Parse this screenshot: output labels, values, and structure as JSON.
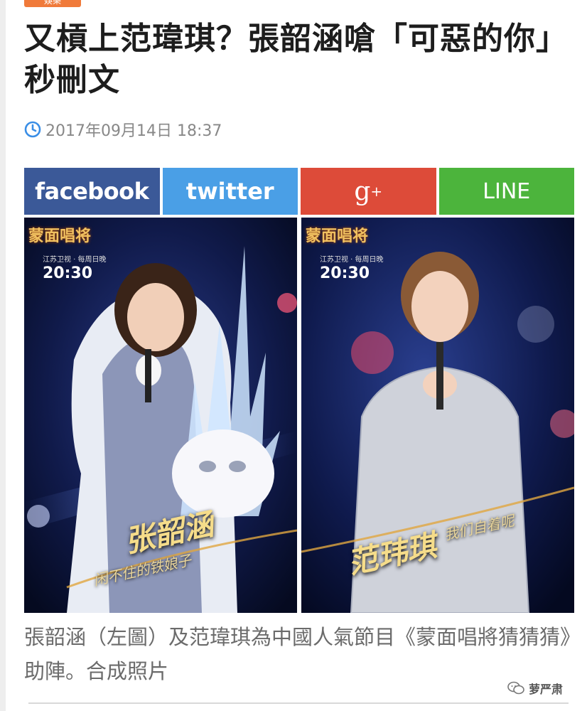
{
  "article": {
    "category": "娛樂",
    "title": "又槓上范瑋琪？張韶涵嗆「可惡的你」秒刪文",
    "date": "2017年09月14日 18:37",
    "caption": "張韶涵（左圖）及范瑋琪為中國人氣節目《蒙面唱將猜猜猜》助陣。合成照片"
  },
  "share": {
    "facebook": "facebook",
    "twitter": "twitter",
    "gplus": "g",
    "gplus_sup": "+",
    "line": "LINE"
  },
  "photo_left": {
    "show_logo": "蒙面唱将",
    "channel": "江苏卫视 · 每周日晚",
    "time": "20:30",
    "name": "张韶涵",
    "subtitle": "闲不住的铁娘子"
  },
  "photo_right": {
    "show_logo": "蒙面唱将",
    "channel": "江苏卫视 · 每周日晚",
    "time": "20:30",
    "name": "范玮琪",
    "subtitle": "我们自着呢"
  },
  "watermark": {
    "text": "萝严肃"
  },
  "colors": {
    "facebook": "#3b5998",
    "twitter": "#4a9fe6",
    "gplus": "#dd4b39",
    "line": "#4cb43c",
    "category": "#f07a3a",
    "date_icon": "#3a8ee6"
  },
  "icons": [
    "clock-icon",
    "wechat-icon"
  ]
}
